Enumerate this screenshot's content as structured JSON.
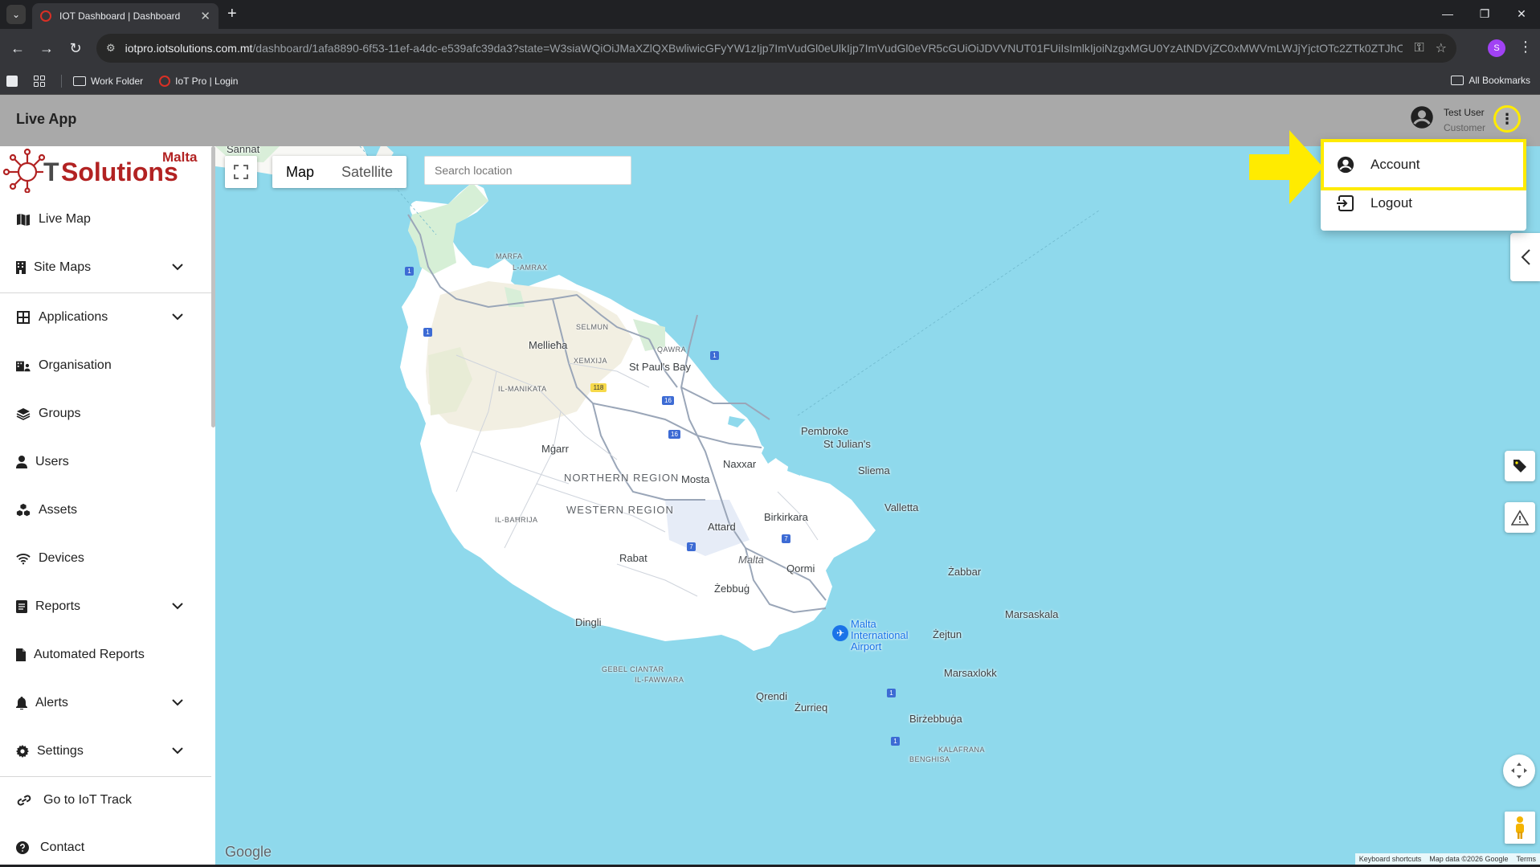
{
  "browser": {
    "tab_title": "IOT Dashboard | Dashboard",
    "url_host": "iotpro.iotsolutions.com.mt",
    "url_path": "/dashboard/1afa8890-6f53-11ef-a4dc-e539afc39da3?state=W3siaWQiOiJMaXZlQXBwliwicGFyYW1zIjp7ImVudGl0eUlkIjp7ImVudGl0eVR5cGUiOiJDVVNUT01FUiIsImlkIjoiNzgxMGU0YzAtNDVjZC0xMWVmLWJjYjctOTc2ZTk0ZTJhODA5In...",
    "profile_initial": "S",
    "bookmarks": [
      {
        "label": "Work Folder"
      },
      {
        "label": "IoT Pro | Login"
      }
    ],
    "all_bookmarks": "All Bookmarks"
  },
  "header": {
    "title": "Live App",
    "user_name": "Test User",
    "user_role": "Customer"
  },
  "logo": {
    "text": "IOT Solutions",
    "country": "Malta",
    "colors": {
      "brand": "#b22222"
    }
  },
  "sidebar": {
    "items": [
      {
        "label": "Live Map",
        "icon": "map-icon"
      },
      {
        "label": "Site Maps",
        "icon": "building-icon",
        "expandable": true
      },
      {
        "label": "Applications",
        "icon": "grid-icon",
        "expandable": true
      },
      {
        "label": "Organisation",
        "icon": "organisation-icon"
      },
      {
        "label": "Groups",
        "icon": "layers-icon"
      },
      {
        "label": "Users",
        "icon": "person-icon"
      },
      {
        "label": "Assets",
        "icon": "cubes-icon"
      },
      {
        "label": "Devices",
        "icon": "wifi-icon"
      },
      {
        "label": "Reports",
        "icon": "report-icon",
        "expandable": true
      },
      {
        "label": "Automated Reports",
        "icon": "file-icon"
      },
      {
        "label": "Alerts",
        "icon": "bell-icon",
        "expandable": true
      },
      {
        "label": "Settings",
        "icon": "gear-icon",
        "expandable": true
      },
      {
        "label": "Go to IoT Track",
        "icon": "link-icon"
      },
      {
        "label": "Contact",
        "icon": "help-icon"
      }
    ]
  },
  "map": {
    "type_buttons": [
      "Map",
      "Satellite"
    ],
    "active_type": "Map",
    "search_placeholder": "Search location",
    "labels": {
      "sannat": "Sannat",
      "marfa": "MARFA",
      "lamrax": "L-AMRAX",
      "selmun": "SELMUN",
      "mellieha": "Mellieħa",
      "qawra": "QAWRA",
      "xemxija": "XEMXIJA",
      "stpauls": "St Paul's Bay",
      "manikata": "IL-MANIKATA",
      "pembroke": "Pembroke",
      "stjulians": "St Julian's",
      "mgarr": "Mġarr",
      "naxxar": "Naxxar",
      "northern": "NORTHERN REGION",
      "mosta": "Mosta",
      "sliema": "Sliema",
      "western": "WESTERN REGION",
      "valletta": "Valletta",
      "bahrija": "IL-BAĦRIJA",
      "birkirkara": "Birkirkara",
      "attard": "Attard",
      "rabat": "Rabat",
      "malta": "Malta",
      "qormi": "Qormi",
      "zabbar": "Żabbar",
      "zebbug": "Żebbuġ",
      "dingli": "Dingli",
      "airport": "Malta\nInternational\nAirport",
      "marsaskala": "Marsaskala",
      "zejtun": "Żejtun",
      "gebel": "GEBEL CIANTAR",
      "fawwara": "IL-FAWWARA",
      "marsaxlokk": "Marsaxlokk",
      "qrendi": "Qrendi",
      "zurrieq": "Żurrieq",
      "birzebbuga": "Birżebbuġa",
      "kalafrana": "KALAFRANA",
      "benghisa": "BENGHISA",
      "r1": "1",
      "r16": "16",
      "r7": "7",
      "r118": "118"
    },
    "google": "Google",
    "attribution": [
      "Keyboard shortcuts",
      "Map data ©2026 Google",
      "Terms"
    ]
  },
  "dropdown": {
    "account": "Account",
    "logout": "Logout"
  },
  "colors": {
    "highlight": "#ffeb00",
    "header_bg": "#a9a9a9",
    "water": "#8fd9ec"
  }
}
